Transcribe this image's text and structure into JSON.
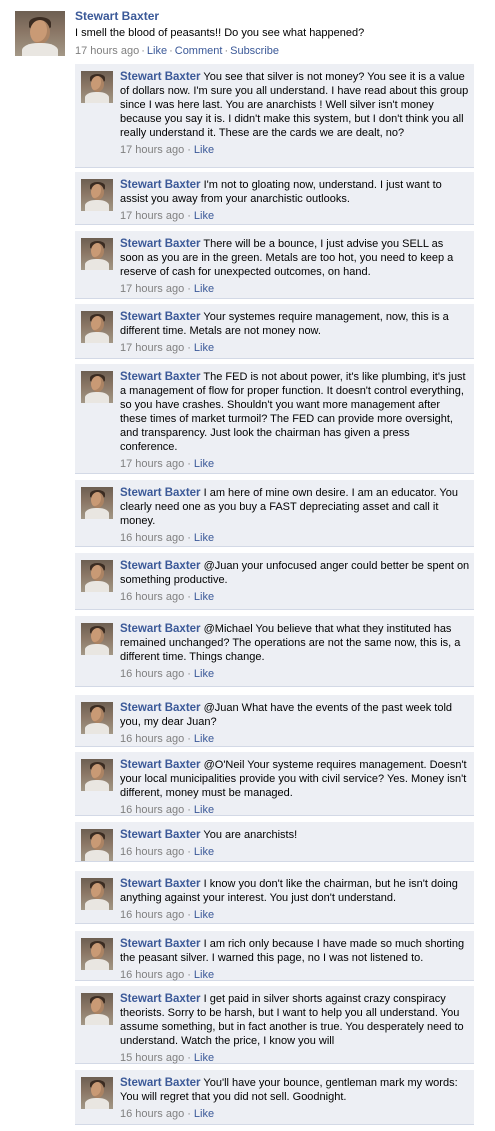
{
  "post": {
    "author": "Stewart Baxter",
    "text": "I smell the blood of peasants!! Do you see what happened?",
    "time": "17 hours ago",
    "actions": [
      "Like",
      "Comment",
      "Subscribe"
    ]
  },
  "comments": [
    {
      "author": "Stewart Baxter",
      "text": "You see that silver is not money? You see it is a value of dollars now. I'm sure you all understand. I have read about this group since I was here last. You are anarchists ! Well silver isn't money because you say it is. I didn't make this system, but I don't think you all really understand it. These are the cards we are dealt, no?",
      "time": "17 hours ago",
      "like": "Like"
    },
    {
      "author": "Stewart Baxter",
      "text": "I'm not to gloating now, understand. I just want to assist you away from your anarchistic outlooks.",
      "time": "17 hours ago",
      "like": "Like"
    },
    {
      "author": "Stewart Baxter",
      "text": "There will be a bounce, I just advise you SELL as soon as you are in the green. Metals are too hot, you need to keep a reserve of cash for unexpected outcomes, on hand.",
      "time": "17 hours ago",
      "like": "Like"
    },
    {
      "author": "Stewart Baxter",
      "text": "Your systemes require management, now, this is a different time. Metals are not money now.",
      "time": "17 hours ago",
      "like": "Like"
    },
    {
      "author": "Stewart Baxter",
      "text": "The FED is not about power, it's like plumbing, it's just a management of flow for proper function. It doesn't control everything, so you have crashes. Shouldn't you want more management after these times of market turmoil? The FED can provide more oversight, and transparency. Just look the chairman has given a press conference.",
      "time": "17 hours ago",
      "like": "Like"
    },
    {
      "author": "Stewart Baxter",
      "text": "I am here of mine own desire. I am an educator. You clearly need one as you buy a FAST depreciating asset and call it money.",
      "time": "16 hours ago",
      "like": "Like"
    },
    {
      "author": "Stewart Baxter",
      "text": "@Juan your unfocused anger could better be spent on something productive.",
      "time": "16 hours ago",
      "like": "Like"
    },
    {
      "author": "Stewart Baxter",
      "text": "@Michael You believe that what they instituted has remained unchanged? The operations are not the same now, this is, a different time. Things change.",
      "time": "16 hours ago",
      "like": "Like"
    },
    {
      "author": "Stewart Baxter",
      "text": "@Juan What have the events of the past week told you, my dear Juan?",
      "time": "16 hours ago",
      "like": "Like"
    },
    {
      "author": "Stewart Baxter",
      "text": "@O'Neil Your systeme requires management. Doesn't your local municipalities provide you with civil service? Yes. Money isn't different, money must be managed.",
      "time": "16 hours ago",
      "like": "Like"
    },
    {
      "author": "Stewart Baxter",
      "text": "You are anarchists!",
      "time": "16 hours ago",
      "like": "Like"
    },
    {
      "author": "Stewart Baxter",
      "text": "I know you don't like the chairman, but he isn't doing anything against your interest. You just don't understand.",
      "time": "16 hours ago",
      "like": "Like"
    },
    {
      "author": "Stewart Baxter",
      "text": "I am rich only because I have made so much shorting the peasant silver. I warned this page, no I was not listened to.",
      "time": "16 hours ago",
      "like": "Like"
    },
    {
      "author": "Stewart Baxter",
      "text": "I get paid in silver shorts against crazy conspiracy theorists. Sorry to be harsh, but I want to help you all understand. You assume something, but in fact another is true. You desperately need to understand. Watch the price, I know you will",
      "time": "15 hours ago",
      "like": "Like"
    },
    {
      "author": "Stewart Baxter",
      "text": "You'll have your bounce, gentleman mark my words: You will regret that you did not sell. Goodnight.",
      "time": "16 hours ago",
      "like": "Like"
    }
  ]
}
